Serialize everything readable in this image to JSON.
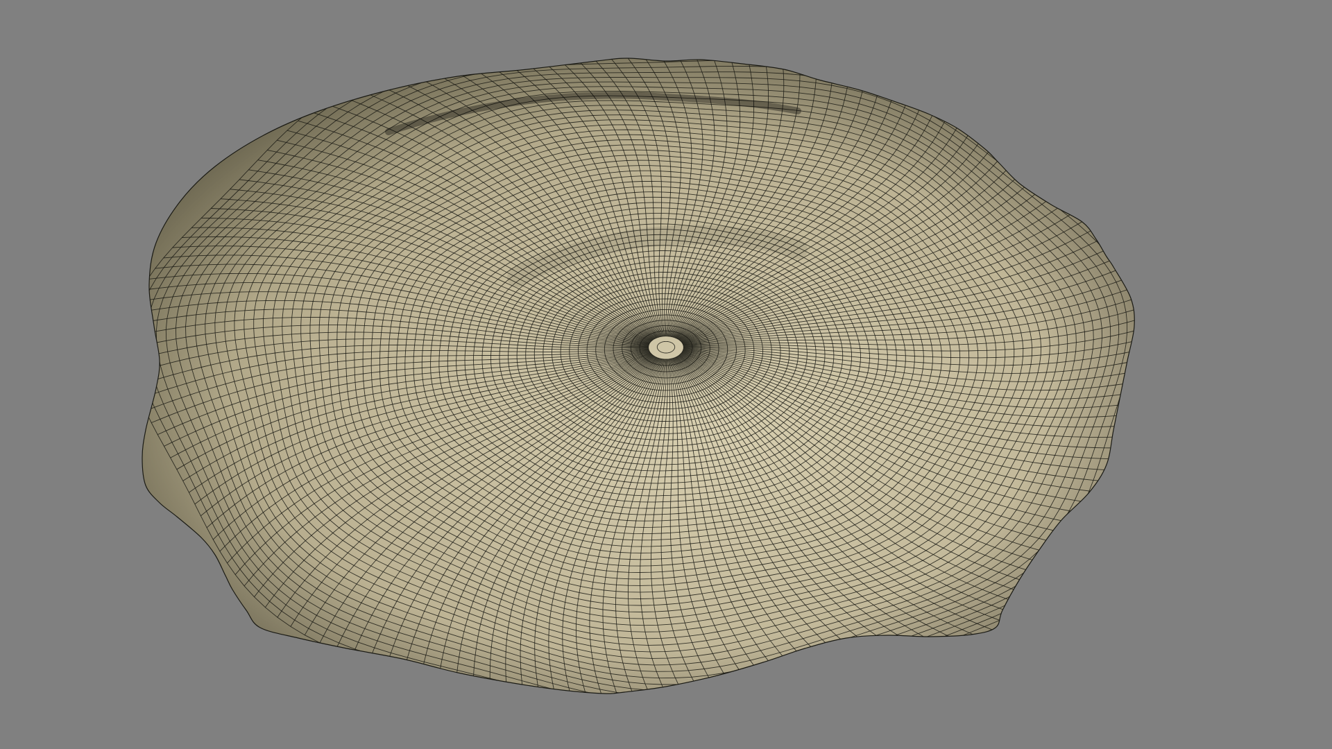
{
  "viewport": {
    "background_color": "#808080",
    "mesh": {
      "object": "draped-cloth-dome",
      "surface_color_light": "#d8cfb0",
      "surface_color_mid": "#bdb394",
      "surface_color_dark": "#8f8868",
      "wire_color": "#1a1a14",
      "shading": "smooth-shaded-with-wireframe"
    }
  }
}
